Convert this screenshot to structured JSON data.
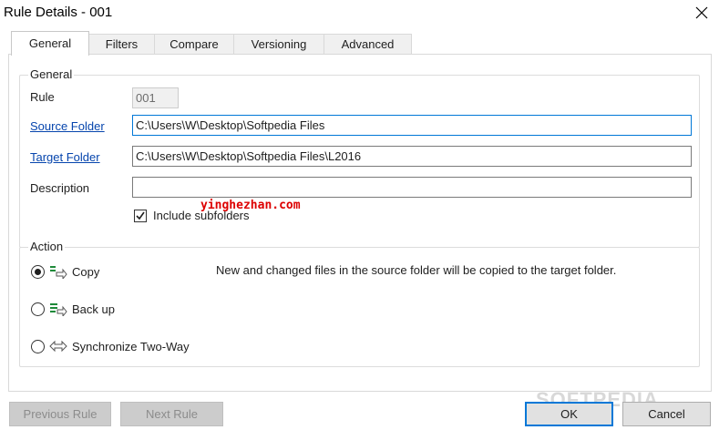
{
  "window": {
    "title": "Rule Details - 001"
  },
  "tabs": [
    {
      "label": "General",
      "active": true
    },
    {
      "label": "Filters"
    },
    {
      "label": "Compare"
    },
    {
      "label": "Versioning"
    },
    {
      "label": "Advanced"
    }
  ],
  "general": {
    "legend": "General",
    "rule_label": "Rule",
    "rule_value": "001",
    "source_label": "Source Folder",
    "source_value": "C:\\Users\\W\\Desktop\\Softpedia Files",
    "target_label": "Target Folder",
    "target_value": "C:\\Users\\W\\Desktop\\Softpedia Files\\L2016",
    "description_label": "Description",
    "description_value": "",
    "include_subfolders_label": "Include subfolders",
    "include_subfolders_checked": true
  },
  "action": {
    "legend": "Action",
    "options": [
      {
        "label": "Copy",
        "icon": "copy-arrow-icon",
        "selected": true
      },
      {
        "label": "Back up",
        "icon": "backup-icon",
        "selected": false
      },
      {
        "label": "Synchronize Two-Way",
        "icon": "sync-two-way-icon",
        "selected": false
      }
    ],
    "description": "New and changed files in the source folder will be copied to the target folder."
  },
  "footer": {
    "previous_rule": "Previous Rule",
    "next_rule": "Next Rule",
    "ok": "OK",
    "cancel": "Cancel"
  },
  "watermarks": {
    "site": "yinghezhan.com",
    "softpedia": "SOFTPEDIA"
  },
  "colors": {
    "link": "#0645ad",
    "default_button_border": "#0078d7",
    "watermark": "#dd0000"
  }
}
